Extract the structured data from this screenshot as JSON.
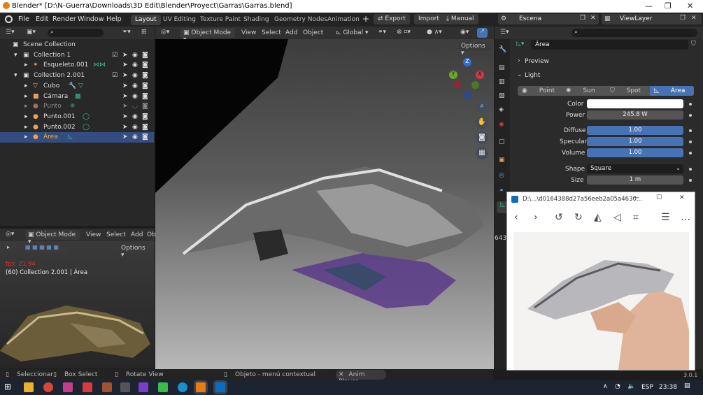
{
  "window": {
    "title": "Blender* [D:\\N-Guerra\\Downloads\\3D Edit\\Blender\\Proyect\\Garras\\Garras.blend]"
  },
  "menu": [
    "File",
    "Edit",
    "Render",
    "Window",
    "Help"
  ],
  "workspaces": [
    "Layout",
    "UV Editing",
    "Texture Paint",
    "Shading",
    "Geometry Nodes",
    "Animation"
  ],
  "header_buttons": {
    "export": "Export",
    "import": "Import",
    "manual": "Manual"
  },
  "scene": {
    "label": "Escena",
    "view_layer": "ViewLayer"
  },
  "outliner": {
    "root": "Scene Collection",
    "rows": [
      {
        "label": "Collection 1"
      },
      {
        "label": "Esqueleto.001"
      },
      {
        "label": "Collection 2.001"
      },
      {
        "label": "Cubo"
      },
      {
        "label": "Cámara"
      },
      {
        "label": "Punto"
      },
      {
        "label": "Punto.001"
      },
      {
        "label": "Punto.002"
      },
      {
        "label": "Área"
      }
    ]
  },
  "viewport": {
    "mode": "Object Mode",
    "menus": [
      "View",
      "Select",
      "Add",
      "Object"
    ],
    "orientation": "Global",
    "options": "Options"
  },
  "viewport_small": {
    "mode": "Object Mode",
    "menus": [
      "View",
      "Select",
      "Add",
      "Ob"
    ],
    "options": "Options",
    "fps": "fps: 21.94",
    "info": "(60) Collection 2.001 | Área"
  },
  "properties": {
    "object_name": "Área",
    "sections": {
      "preview": "Preview",
      "light": "Light"
    },
    "light_types": [
      "Point",
      "Sun",
      "Spot",
      "Area"
    ],
    "active_light_type": "Area",
    "fields": {
      "color_label": "Color",
      "power_label": "Power",
      "power": "245.8 W",
      "diffuse_label": "Diffuse",
      "diffuse": "1.00",
      "specular_label": "Specular",
      "specular": "1.00",
      "volume_label": "Volume",
      "volume": "1.00",
      "shape_label": "Shape",
      "shape": "Square",
      "size_label": "Size",
      "size": "1 m"
    }
  },
  "photo_viewer": {
    "title": "D:\\...\\d0164388d27a56eeb2a05a4630...",
    "side_number": "643",
    "version": "3.0.1"
  },
  "statusbar": {
    "select": "Seleccionar",
    "box": "Box Select",
    "rotate": "Rotate View",
    "context": "Objeto - menú contextual",
    "anim": "Anim Player"
  },
  "taskbar": {
    "lang": "ESP",
    "time": "23:38"
  },
  "colors": {
    "accent": "#4772b3",
    "bg": "#1d1d1d",
    "panel": "#282828",
    "selected_row": "#334d80"
  }
}
